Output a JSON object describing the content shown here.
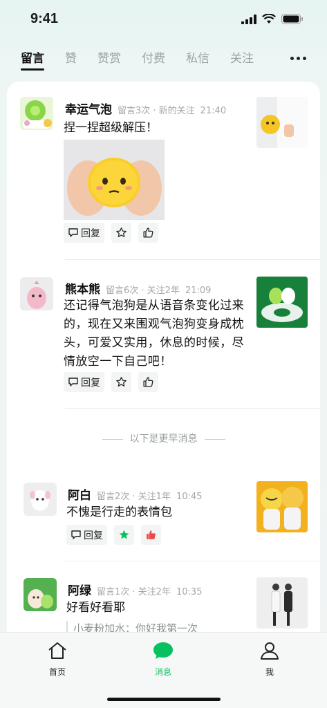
{
  "status_bar": {
    "time": "9:41"
  },
  "tabs": [
    {
      "label": "留言",
      "active": true
    },
    {
      "label": "赞"
    },
    {
      "label": "赞赏"
    },
    {
      "label": "付费"
    },
    {
      "label": "私信"
    },
    {
      "label": "关注"
    }
  ],
  "messages": [
    {
      "user": "幸运气泡",
      "meta": "留言3次 · 新的关注",
      "time": "21:40",
      "text": "捏一捏超级解压！",
      "has_image": true,
      "actions": {
        "reply": "回复"
      }
    },
    {
      "user": "熊本熊",
      "meta": "留言6次 · 关注2年",
      "time": "21:09",
      "text": "还记得气泡狗是从语音条变化过来的，现在又来围观气泡狗变身成枕头，可爱又实用，休息的时候，尽情放空一下自己吧！",
      "actions": {
        "reply": "回复"
      }
    },
    {
      "user": "阿白",
      "meta": "留言2次 · 关注1年",
      "time": "10:45",
      "text": "不愧是行走的表情包",
      "actions": {
        "reply": "回复",
        "starred": true,
        "liked": true
      }
    },
    {
      "user": "阿绿",
      "meta": "留言1次 · 关注2年",
      "time": "10:35",
      "text": "好看好看耶",
      "reply_preview": "小麦粉加水：你好我第一次"
    }
  ],
  "separator": "以下是更早消息",
  "bottom_nav": [
    {
      "label": "首页"
    },
    {
      "label": "消息",
      "active": true
    },
    {
      "label": "我"
    }
  ],
  "colors": {
    "accent": "#07c160",
    "like_red": "#f04848"
  }
}
